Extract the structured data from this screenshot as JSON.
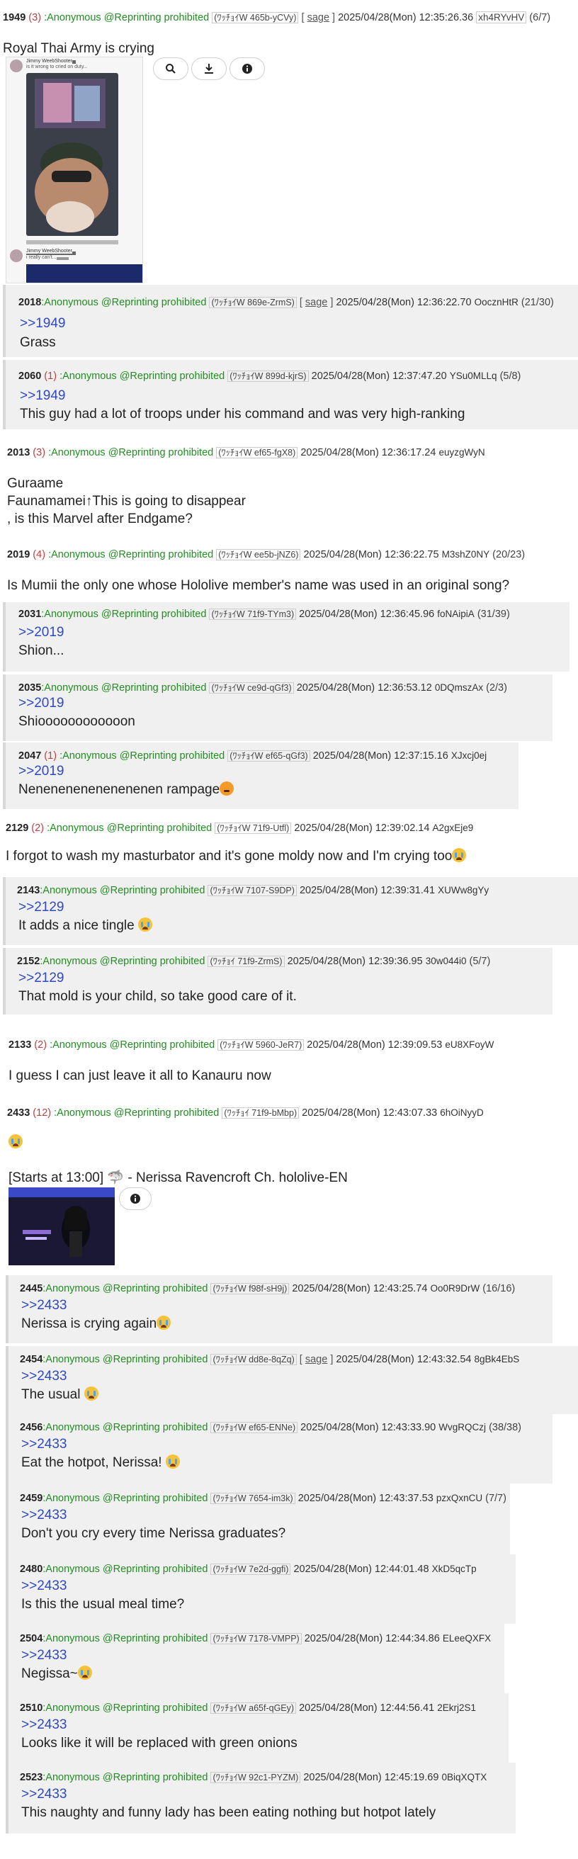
{
  "name_label": ":Anonymous @Reprinting prohibited",
  "op": {
    "num": "1949",
    "count": "(3)",
    "id": "(ﾜｯﾁｮｲW 465b-yCVy)",
    "sage": "sage",
    "date": "2025/04/28(Mon) 12:35:26.36",
    "uid": "xh4RYvHV",
    "ratio": "(6/7)",
    "title": "Royal Thai Army is crying",
    "screenshot": {
      "author": "Jimmy WeebShooter",
      "caption": "is it wrong to cried on duty...",
      "author2": "Jimmy WeebShooter",
      "caption2": "i really can't..."
    }
  },
  "posts": [
    {
      "num": "2018",
      "id": "(ﾜｯﾁｮｲW 869e-ZrmS)",
      "sage": "sage",
      "date": "2025/04/28(Mon) 12:36:22.70",
      "uid": "OocznHtR",
      "ratio": "(21/30)",
      "quote": ">>1949",
      "text": "Grass"
    },
    {
      "num": "2060",
      "count": "(1)",
      "id": "(ﾜｯﾁｮｲW 899d-kjrS)",
      "date": "2025/04/28(Mon) 12:37:47.20",
      "uid": "YSu0MLLq",
      "ratio": "(5/8)",
      "quote": ">>1949",
      "text": "This guy had a lot of troops under his command and was very high-ranking"
    },
    {
      "num": "2013",
      "count": "(3)",
      "id": "(ﾜｯﾁｮｲW ef65-fgX8)",
      "date": "2025/04/28(Mon) 12:36:17.24",
      "uid": "euyzgWyN",
      "text": "Guraame\nFaunamamei↑This is going to disappear\n, is this Marvel after Endgame?"
    },
    {
      "num": "2019",
      "count": "(4)",
      "id": "(ﾜｯﾁｮｲW ee5b-jNZ6)",
      "date": "2025/04/28(Mon) 12:36:22.75",
      "uid": "M3shZ0NY",
      "ratio": "(20/23)",
      "text": "Is Mumii the only one whose Hololive member's name was used in an original song?"
    },
    {
      "num": "2031",
      "id": "(ﾜｯﾁｮｲW 71f9-TYm3)",
      "date": "2025/04/28(Mon) 12:36:45.96",
      "uid": "foNAipiA",
      "ratio": "(31/39)",
      "quote": ">>2019",
      "text": "Shion..."
    },
    {
      "num": "2035",
      "id": "(ﾜｯﾁｮｲW ce9d-qGf3)",
      "date": "2025/04/28(Mon) 12:36:53.12",
      "uid": "0DQmszAx",
      "ratio": "(2/3)",
      "quote": ">>2019",
      "text": "Shioooooooooooon"
    },
    {
      "num": "2047",
      "count": "(1)",
      "id": "(ﾜｯﾁｮｲW ef65-qGf3)",
      "date": "2025/04/28(Mon) 12:37:15.16",
      "uid": "XJxcj0ej",
      "quote": ">>2019",
      "text": "Nenenenenenenenenen rampage"
    },
    {
      "num": "2129",
      "count": "(2)",
      "id": "(ﾜｯﾁｮｲW 71f9-Utfl)",
      "date": "2025/04/28(Mon) 12:39:02.14",
      "uid": "A2gxEje9",
      "text": "I forgot to wash my masturbator and it's gone moldy now and I'm crying too"
    },
    {
      "num": "2143",
      "id": "(ﾜｯﾁｮｲW 7107-S9DP)",
      "date": "2025/04/28(Mon) 12:39:31.41",
      "uid": "XUWw8gYy",
      "quote": ">>2129",
      "text": "It adds a nice tingle"
    },
    {
      "num": "2152",
      "id": "(ﾜｯﾁｮｲ 71f9-ZrmS)",
      "date": "2025/04/28(Mon) 12:39:36.95",
      "uid": "30w044i0",
      "ratio": "(5/7)",
      "quote": ">>2129",
      "text": "That mold is your child, so take good care of it."
    },
    {
      "num": "2133",
      "count": "(2)",
      "id": "(ﾜｯﾁｮｲW 5960-JeR7)",
      "date": "2025/04/28(Mon) 12:39:09.53",
      "uid": "eU8XFoyW",
      "text": "I guess I can just leave it all to Kanauru now"
    },
    {
      "num": "2433",
      "count": "(12)",
      "id": "(ﾜｯﾁｮｲ 71f9-bMbp)",
      "date": "2025/04/28(Mon) 12:43:07.33",
      "uid": "6hOiNyyD",
      "text": "",
      "embed": "[Starts at 13:00] 🦈 - Nerissa Ravencroft Ch. hololive-EN"
    },
    {
      "num": "2445",
      "id": "(ﾜｯﾁｮｲW f98f-sH9j)",
      "date": "2025/04/28(Mon) 12:43:25.74",
      "uid": "Oo0R9DrW",
      "ratio": "(16/16)",
      "quote": ">>2433",
      "text": "Nerissa is crying again"
    },
    {
      "num": "2454",
      "id": "(ﾜｯﾁｮｲW dd8e-8qZq)",
      "sage": "sage",
      "date": "2025/04/28(Mon) 12:43:32.54",
      "uid": "8gBk4EbS",
      "quote": ">>2433",
      "text": "The usual"
    },
    {
      "num": "2456",
      "id": "(ﾜｯﾁｮｲW ef65-ENNe)",
      "date": "2025/04/28(Mon) 12:43:33.90",
      "uid": "WvgRQCzj",
      "ratio": "(38/38)",
      "quote": ">>2433",
      "text": "Eat the hotpot, Nerissa!"
    },
    {
      "num": "2459",
      "id": "(ﾜｯﾁｮｲW 7654-im3k)",
      "date": "2025/04/28(Mon) 12:43:37.53",
      "uid": "pzxQxnCU",
      "ratio": "(7/7)",
      "quote": ">>2433",
      "text": "Don't you cry every time Nerissa graduates?"
    },
    {
      "num": "2480",
      "id": "(ﾜｯﾁｮｲW 7e2d-ggfi)",
      "date": "2025/04/28(Mon) 12:44:01.48",
      "uid": "XkD5qcTp",
      "quote": ">>2433",
      "text": "Is this the usual meal time?"
    },
    {
      "num": "2504",
      "id": "(ﾜｯﾁｮｲW 7178-VMPP)",
      "date": "2025/04/28(Mon) 12:44:34.86",
      "uid": "ELeeQXFX",
      "quote": ">>2433",
      "text": "Negissa~"
    },
    {
      "num": "2510",
      "id": "(ﾜｯﾁｮｲW a65f-qGEy)",
      "date": "2025/04/28(Mon) 12:44:56.41",
      "uid": "2Ekrj2S1",
      "quote": ">>2433",
      "text": "Looks like it will be replaced with green onions"
    },
    {
      "num": "2523",
      "id": "(ﾜｯﾁｮｲW 92c1-PYZM)",
      "date": "2025/04/28(Mon) 12:45:19.69",
      "uid": "0BiqXQTX",
      "quote": ">>2433",
      "text": "This naughty and funny lady has been eating nothing but hotpot lately"
    }
  ],
  "colors": {
    "name": "#1f8f1f",
    "quote": "#2f49c4",
    "count": "#c04040",
    "reply_bg": "#f0f0f0"
  },
  "icons": {
    "search": "search-icon",
    "download": "download-icon",
    "info": "info-icon",
    "emoji_cry": "loudly-crying-face-icon"
  }
}
